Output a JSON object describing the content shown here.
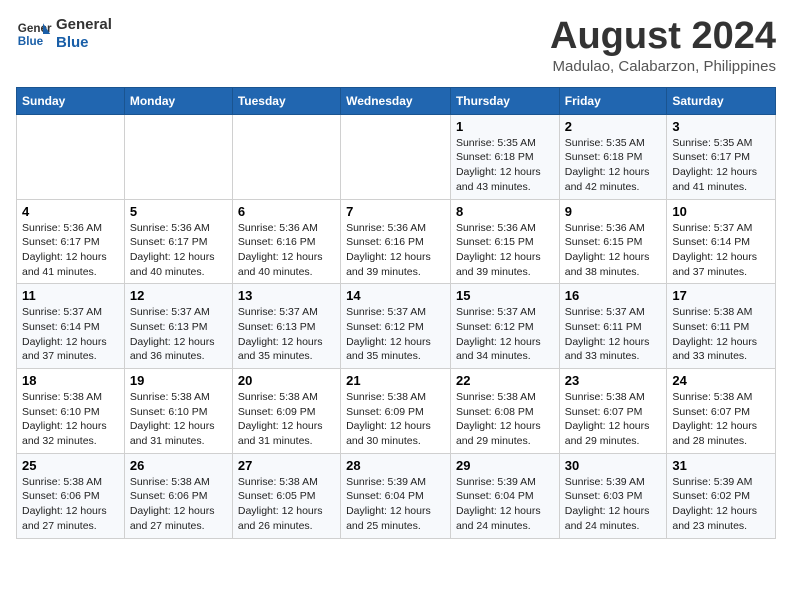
{
  "header": {
    "logo_line1": "General",
    "logo_line2": "Blue",
    "title": "August 2024",
    "subtitle": "Madulao, Calabarzon, Philippines"
  },
  "weekdays": [
    "Sunday",
    "Monday",
    "Tuesday",
    "Wednesday",
    "Thursday",
    "Friday",
    "Saturday"
  ],
  "weeks": [
    [
      {
        "day": "",
        "info": ""
      },
      {
        "day": "",
        "info": ""
      },
      {
        "day": "",
        "info": ""
      },
      {
        "day": "",
        "info": ""
      },
      {
        "day": "1",
        "info": "Sunrise: 5:35 AM\nSunset: 6:18 PM\nDaylight: 12 hours\nand 43 minutes."
      },
      {
        "day": "2",
        "info": "Sunrise: 5:35 AM\nSunset: 6:18 PM\nDaylight: 12 hours\nand 42 minutes."
      },
      {
        "day": "3",
        "info": "Sunrise: 5:35 AM\nSunset: 6:17 PM\nDaylight: 12 hours\nand 41 minutes."
      }
    ],
    [
      {
        "day": "4",
        "info": "Sunrise: 5:36 AM\nSunset: 6:17 PM\nDaylight: 12 hours\nand 41 minutes."
      },
      {
        "day": "5",
        "info": "Sunrise: 5:36 AM\nSunset: 6:17 PM\nDaylight: 12 hours\nand 40 minutes."
      },
      {
        "day": "6",
        "info": "Sunrise: 5:36 AM\nSunset: 6:16 PM\nDaylight: 12 hours\nand 40 minutes."
      },
      {
        "day": "7",
        "info": "Sunrise: 5:36 AM\nSunset: 6:16 PM\nDaylight: 12 hours\nand 39 minutes."
      },
      {
        "day": "8",
        "info": "Sunrise: 5:36 AM\nSunset: 6:15 PM\nDaylight: 12 hours\nand 39 minutes."
      },
      {
        "day": "9",
        "info": "Sunrise: 5:36 AM\nSunset: 6:15 PM\nDaylight: 12 hours\nand 38 minutes."
      },
      {
        "day": "10",
        "info": "Sunrise: 5:37 AM\nSunset: 6:14 PM\nDaylight: 12 hours\nand 37 minutes."
      }
    ],
    [
      {
        "day": "11",
        "info": "Sunrise: 5:37 AM\nSunset: 6:14 PM\nDaylight: 12 hours\nand 37 minutes."
      },
      {
        "day": "12",
        "info": "Sunrise: 5:37 AM\nSunset: 6:13 PM\nDaylight: 12 hours\nand 36 minutes."
      },
      {
        "day": "13",
        "info": "Sunrise: 5:37 AM\nSunset: 6:13 PM\nDaylight: 12 hours\nand 35 minutes."
      },
      {
        "day": "14",
        "info": "Sunrise: 5:37 AM\nSunset: 6:12 PM\nDaylight: 12 hours\nand 35 minutes."
      },
      {
        "day": "15",
        "info": "Sunrise: 5:37 AM\nSunset: 6:12 PM\nDaylight: 12 hours\nand 34 minutes."
      },
      {
        "day": "16",
        "info": "Sunrise: 5:37 AM\nSunset: 6:11 PM\nDaylight: 12 hours\nand 33 minutes."
      },
      {
        "day": "17",
        "info": "Sunrise: 5:38 AM\nSunset: 6:11 PM\nDaylight: 12 hours\nand 33 minutes."
      }
    ],
    [
      {
        "day": "18",
        "info": "Sunrise: 5:38 AM\nSunset: 6:10 PM\nDaylight: 12 hours\nand 32 minutes."
      },
      {
        "day": "19",
        "info": "Sunrise: 5:38 AM\nSunset: 6:10 PM\nDaylight: 12 hours\nand 31 minutes."
      },
      {
        "day": "20",
        "info": "Sunrise: 5:38 AM\nSunset: 6:09 PM\nDaylight: 12 hours\nand 31 minutes."
      },
      {
        "day": "21",
        "info": "Sunrise: 5:38 AM\nSunset: 6:09 PM\nDaylight: 12 hours\nand 30 minutes."
      },
      {
        "day": "22",
        "info": "Sunrise: 5:38 AM\nSunset: 6:08 PM\nDaylight: 12 hours\nand 29 minutes."
      },
      {
        "day": "23",
        "info": "Sunrise: 5:38 AM\nSunset: 6:07 PM\nDaylight: 12 hours\nand 29 minutes."
      },
      {
        "day": "24",
        "info": "Sunrise: 5:38 AM\nSunset: 6:07 PM\nDaylight: 12 hours\nand 28 minutes."
      }
    ],
    [
      {
        "day": "25",
        "info": "Sunrise: 5:38 AM\nSunset: 6:06 PM\nDaylight: 12 hours\nand 27 minutes."
      },
      {
        "day": "26",
        "info": "Sunrise: 5:38 AM\nSunset: 6:06 PM\nDaylight: 12 hours\nand 27 minutes."
      },
      {
        "day": "27",
        "info": "Sunrise: 5:38 AM\nSunset: 6:05 PM\nDaylight: 12 hours\nand 26 minutes."
      },
      {
        "day": "28",
        "info": "Sunrise: 5:39 AM\nSunset: 6:04 PM\nDaylight: 12 hours\nand 25 minutes."
      },
      {
        "day": "29",
        "info": "Sunrise: 5:39 AM\nSunset: 6:04 PM\nDaylight: 12 hours\nand 24 minutes."
      },
      {
        "day": "30",
        "info": "Sunrise: 5:39 AM\nSunset: 6:03 PM\nDaylight: 12 hours\nand 24 minutes."
      },
      {
        "day": "31",
        "info": "Sunrise: 5:39 AM\nSunset: 6:02 PM\nDaylight: 12 hours\nand 23 minutes."
      }
    ]
  ]
}
